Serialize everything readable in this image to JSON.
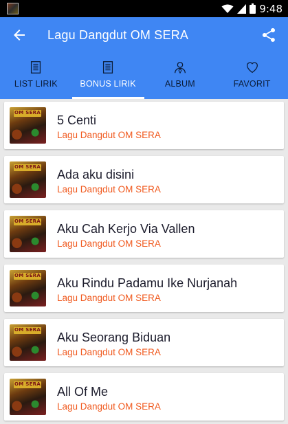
{
  "status_bar": {
    "time": "9:48",
    "icons": [
      "app-icon",
      "wifi-icon",
      "signal-icon",
      "battery-icon"
    ]
  },
  "toolbar": {
    "back_icon": "arrow-left-icon",
    "title": "Lagu Dangdut OM SERA",
    "share_icon": "share-icon"
  },
  "colors": {
    "primary": "#3f86f3",
    "artist_text": "#f0591e",
    "background": "#e9e9e9"
  },
  "tabs": [
    {
      "label": "LIST LIRIK",
      "icon": "document-icon",
      "active": false
    },
    {
      "label": "BONUS LIRIK",
      "icon": "document-icon",
      "active": true
    },
    {
      "label": "ALBUM",
      "icon": "user-icon",
      "active": false
    },
    {
      "label": "FAVORIT",
      "icon": "heart-icon",
      "active": false
    }
  ],
  "songs": [
    {
      "title": "5 Centi",
      "artist": "Lagu Dangdut OM SERA",
      "thumb_text": "OM SERA"
    },
    {
      "title": "Ada aku disini",
      "artist": "Lagu Dangdut OM SERA",
      "thumb_text": "OM SERA"
    },
    {
      "title": "Aku Cah Kerjo Via Vallen",
      "artist": "Lagu Dangdut OM SERA",
      "thumb_text": "OM SERA"
    },
    {
      "title": "Aku Rindu Padamu Ike Nurjanah",
      "artist": "Lagu Dangdut OM SERA",
      "thumb_text": "OM SERA"
    },
    {
      "title": "Aku Seorang Biduan",
      "artist": "Lagu Dangdut OM SERA",
      "thumb_text": "OM SERA"
    },
    {
      "title": "All Of Me",
      "artist": "Lagu Dangdut OM SERA",
      "thumb_text": "OM SERA"
    }
  ]
}
